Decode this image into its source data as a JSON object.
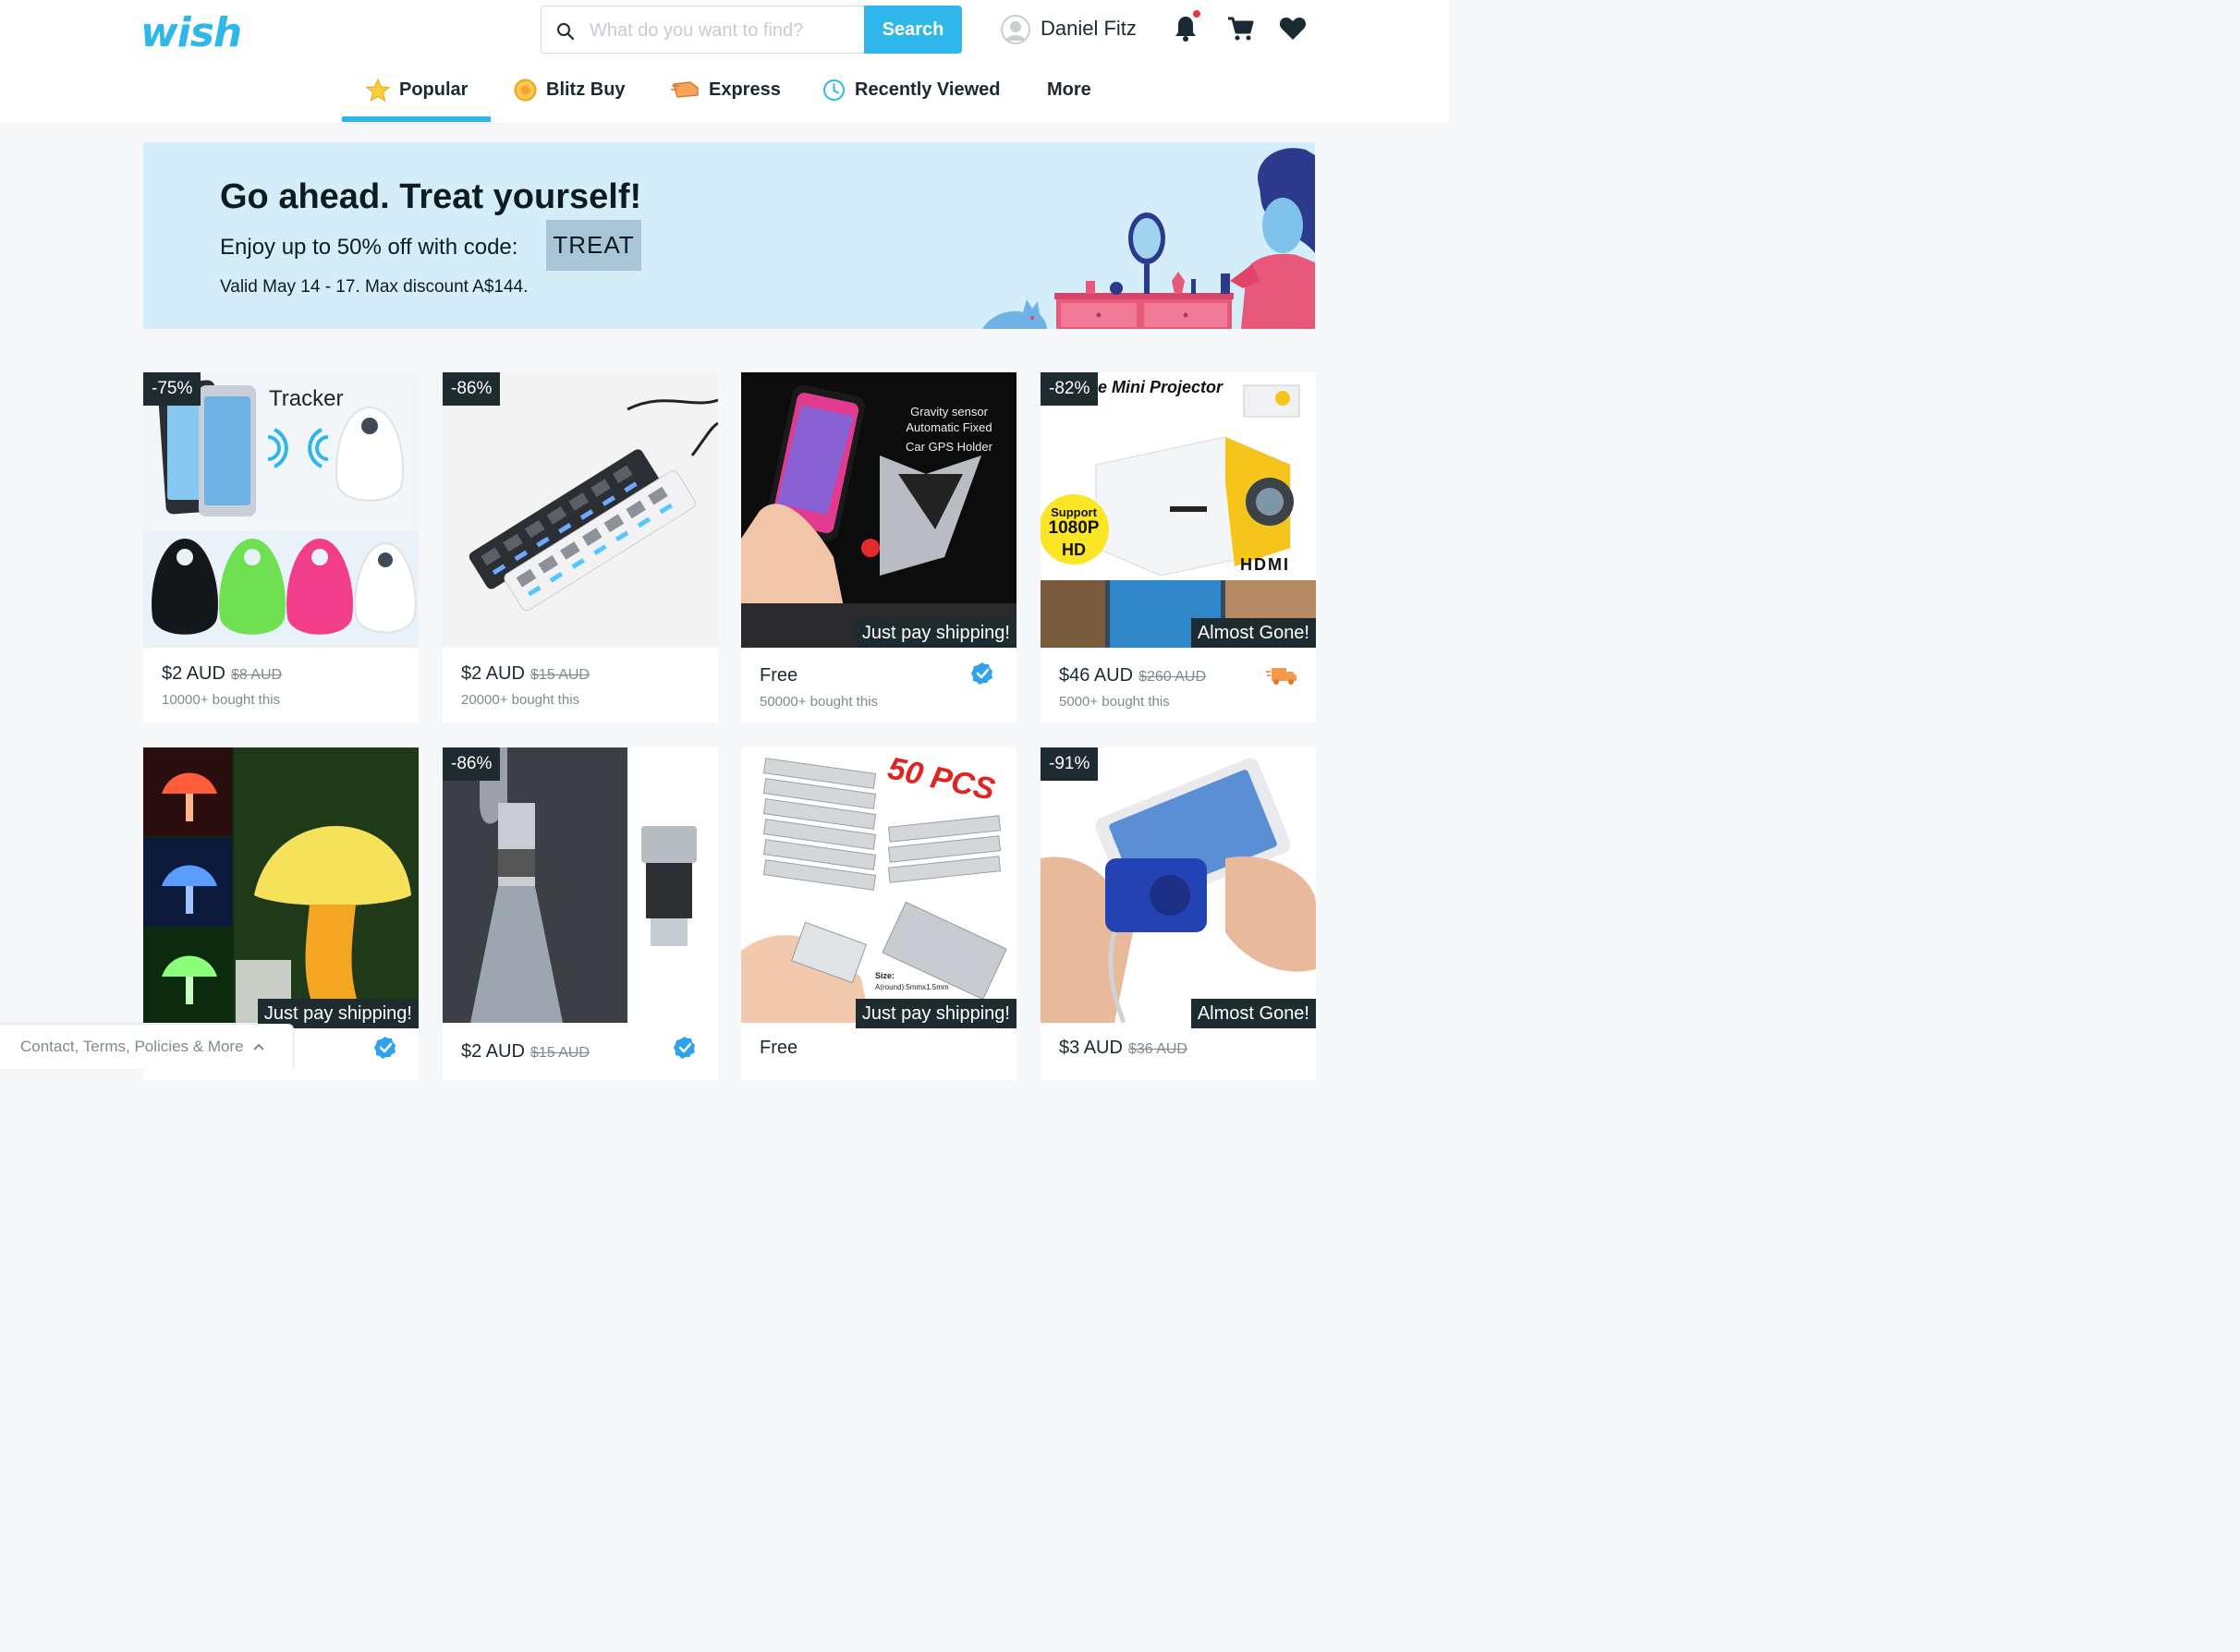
{
  "brand": {
    "logo_text": "wish",
    "accent": "#2fb7ec"
  },
  "search": {
    "placeholder": "What do you want to find?",
    "button_label": "Search"
  },
  "user": {
    "name": "Daniel Fitz"
  },
  "header_icons": [
    "bell-icon",
    "cart-icon",
    "heart-icon"
  ],
  "tabs": [
    {
      "label": "Popular",
      "icon": "star-icon",
      "active": true
    },
    {
      "label": "Blitz Buy",
      "icon": "blitz-coin-icon"
    },
    {
      "label": "Express",
      "icon": "express-icon"
    },
    {
      "label": "Recently Viewed",
      "icon": "clock-icon"
    },
    {
      "label": "More"
    }
  ],
  "banner": {
    "title": "Go ahead. Treat yourself!",
    "subtitle": "Enjoy up to 50% off with code:",
    "code": "TREAT",
    "valid": "Valid May 14 - 17. Max discount A$144."
  },
  "products": [
    {
      "discount": "-75%",
      "price": "$2 AUD",
      "old_price": "$8 AUD",
      "bought": "10000+ bought this",
      "image_text": "Tracker"
    },
    {
      "discount": "-86%",
      "price": "$2 AUD",
      "old_price": "$15 AUD",
      "bought": "20000+ bought this"
    },
    {
      "overlay": "Just pay shipping!",
      "price": "Free",
      "bought": "50000+ bought this",
      "verified": true,
      "image_text": [
        "Gravity sensor",
        "Automatic Fixed",
        "Car GPS Holder"
      ]
    },
    {
      "discount": "-82%",
      "overlay": "Almost Gone!",
      "price": "$46 AUD",
      "old_price": "$260 AUD",
      "bought": "5000+ bought this",
      "express": true,
      "image_text": [
        "e Mini Projector",
        "Support",
        "1080P",
        "HD",
        "HDMI"
      ]
    },
    {
      "overlay": "Just pay shipping!",
      "verified": true
    },
    {
      "discount": "-86%",
      "price": "$2 AUD",
      "old_price": "$15 AUD",
      "verified": true
    },
    {
      "overlay": "Just pay shipping!",
      "price": "Free",
      "image_text": [
        "50 PCS",
        "Size:",
        "A(round):5mmx1.5mm"
      ]
    },
    {
      "discount": "-91%",
      "overlay": "Almost Gone!",
      "price": "$3 AUD",
      "old_price": "$36 AUD"
    }
  ],
  "footer": {
    "link_label": "Contact, Terms, Policies & More"
  }
}
